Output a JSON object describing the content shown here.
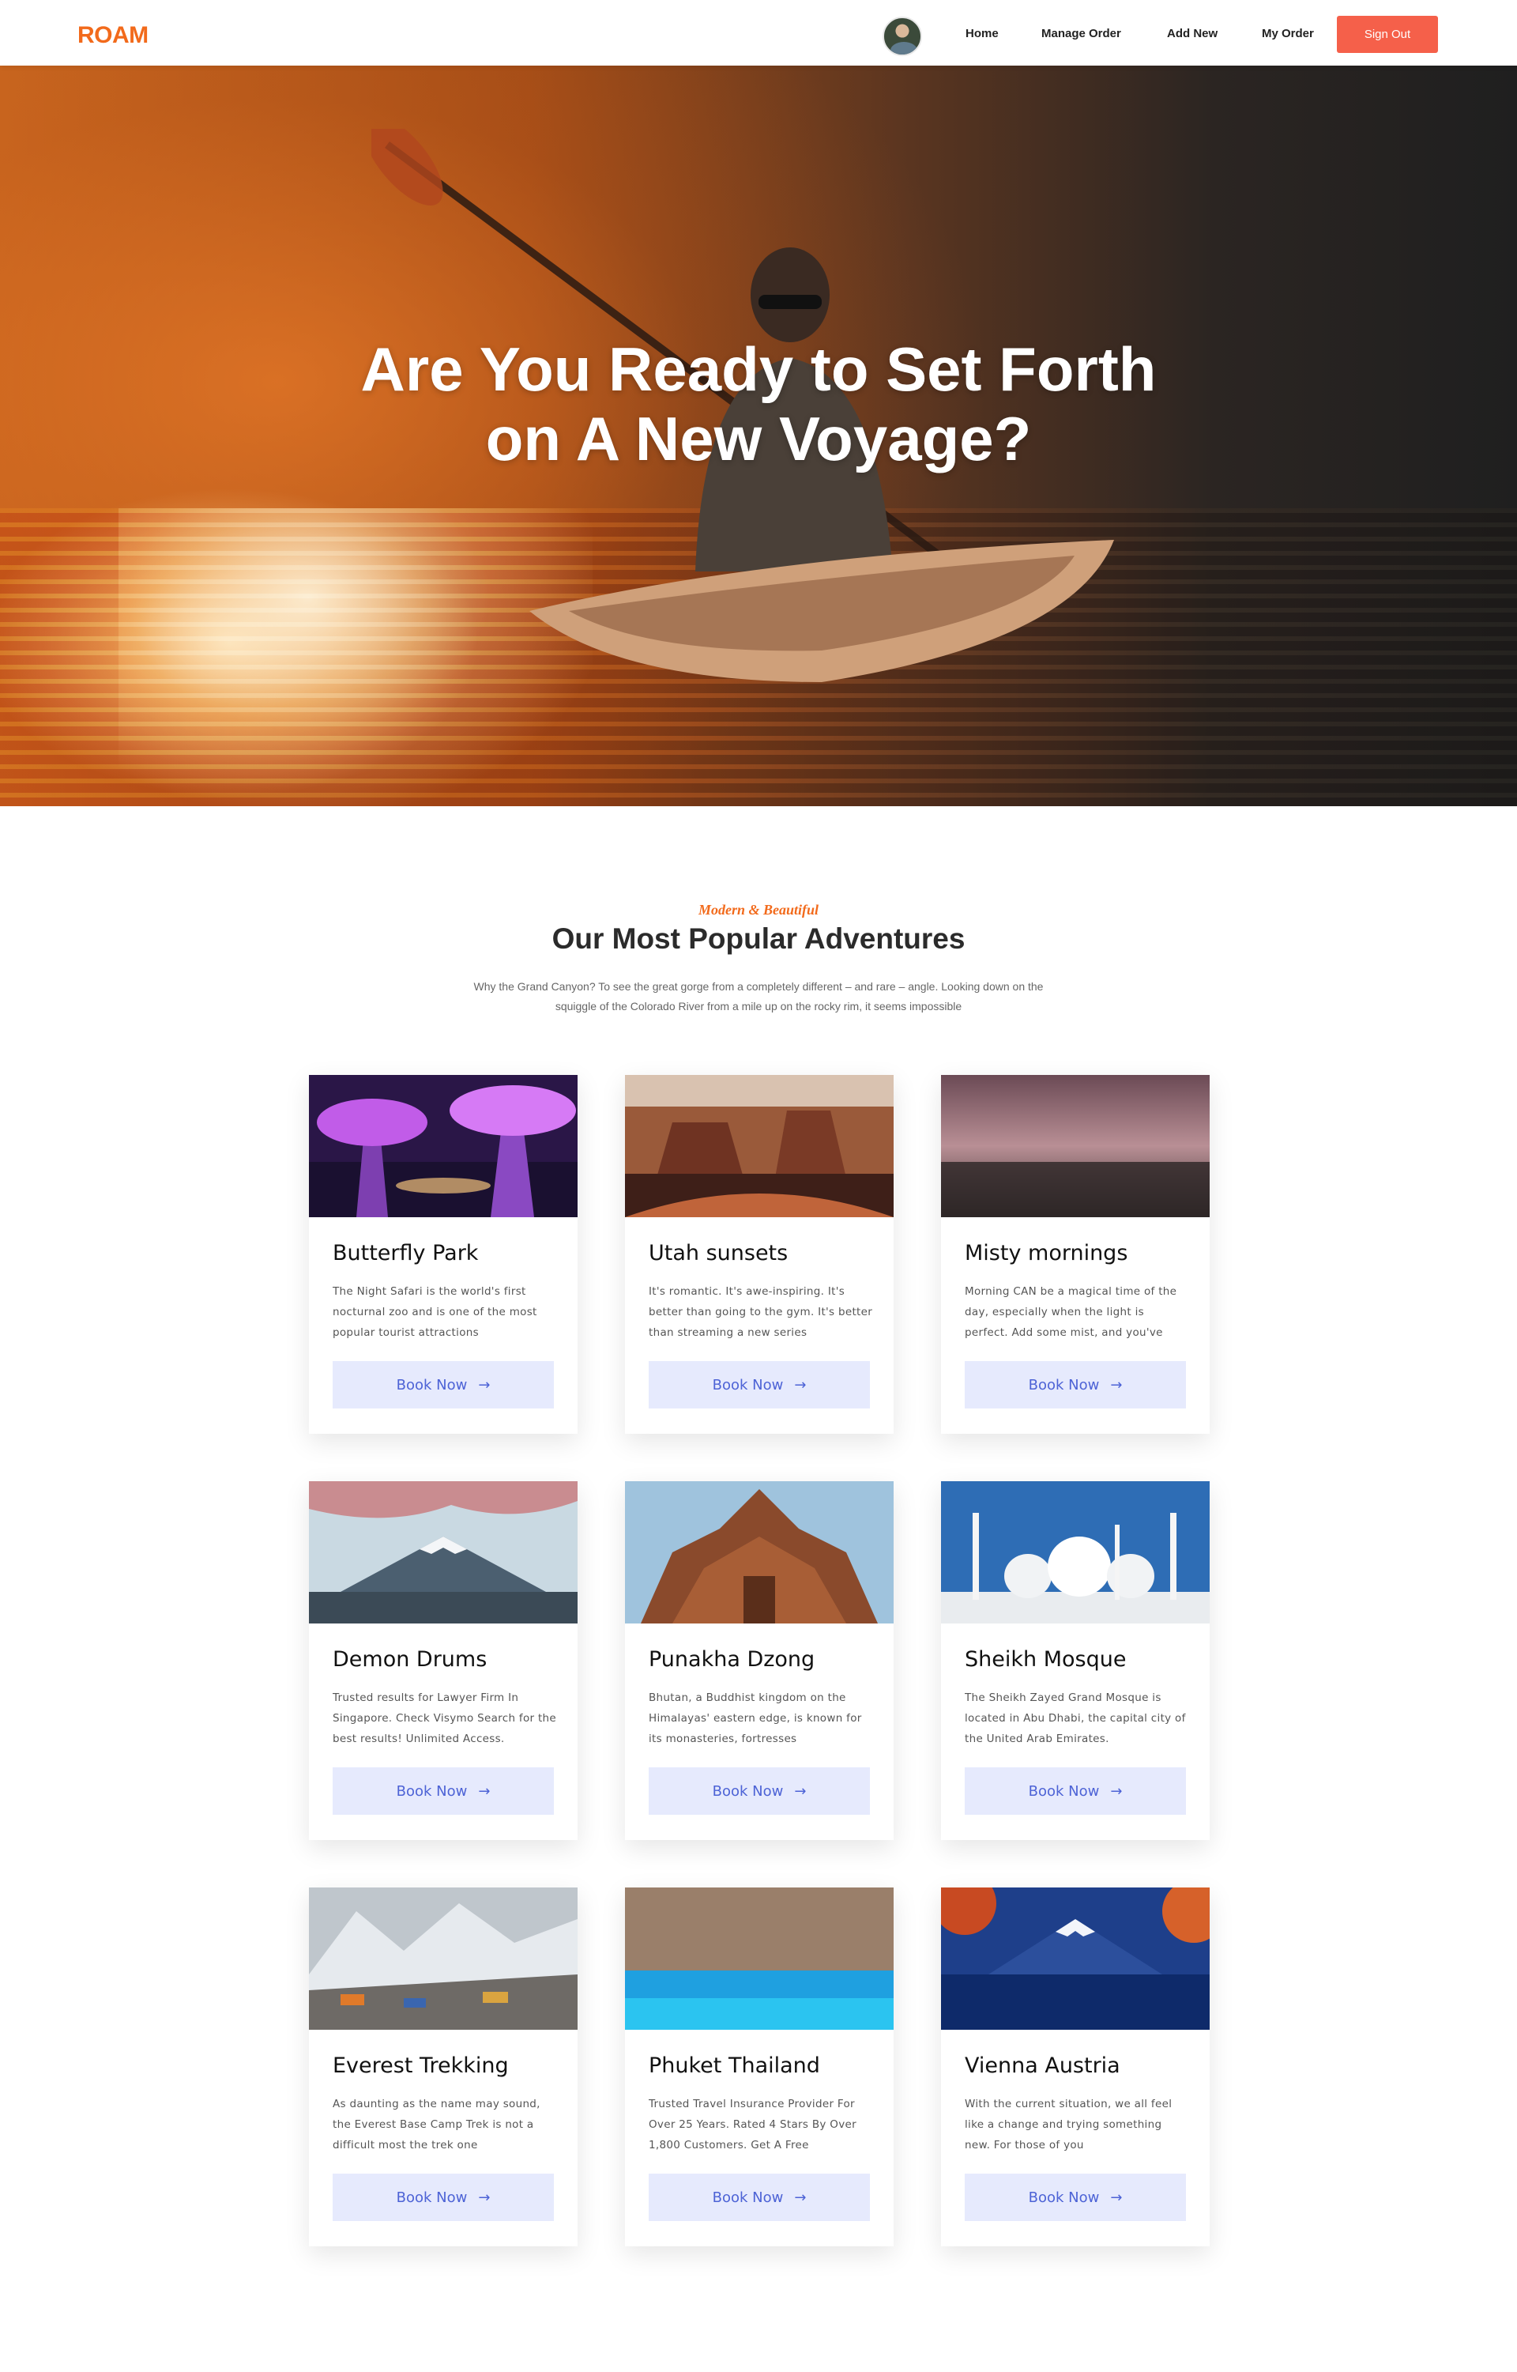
{
  "brand": {
    "logo": "ROAM",
    "accent": "#f26a1b",
    "button_color": "#f5604a"
  },
  "nav": {
    "links": [
      "Home",
      "Manage Order",
      "Add New",
      "My Order"
    ],
    "sign_out": "Sign Out"
  },
  "hero": {
    "title_line1": "Are You Ready to Set Forth",
    "title_line2": "on A New Voyage?"
  },
  "section": {
    "eyebrow": "Modern & Beautiful",
    "title": "Our Most Popular Adventures",
    "description": "Why the Grand Canyon? To see the great gorge from a completely different – and rare – angle. Looking down on the squiggle of the Colorado River from a mile up on the rocky rim, it seems impossible"
  },
  "cards": [
    {
      "title": "Butterfly Park",
      "desc": "The Night Safari is the world's first nocturnal zoo and is one of the most popular tourist attractions",
      "button": "Book Now",
      "image": "supertrees-photo"
    },
    {
      "title": "Utah sunsets",
      "desc": "It's romantic. It's awe-inspiring. It's better than going to the gym. It's better than streaming a new series",
      "button": "Book Now",
      "image": "monument-valley-photo"
    },
    {
      "title": "Misty mornings",
      "desc": "Morning CAN be a magical time of the day, especially when the light is perfect. Add some mist, and you've",
      "button": "Book Now",
      "image": "misty-field-photo"
    },
    {
      "title": "Demon Drums",
      "desc": "Trusted results for Lawyer Firm In Singapore. Check Visymo Search for the best results! Unlimited Access.",
      "button": "Book Now",
      "image": "mount-fuji-blossom-photo"
    },
    {
      "title": "Punakha Dzong",
      "desc": "Bhutan, a Buddhist kingdom on the Himalayas' eastern edge, is known for its monasteries, fortresses",
      "button": "Book Now",
      "image": "wooden-temple-photo"
    },
    {
      "title": "Sheikh Mosque",
      "desc": "The Sheikh Zayed Grand Mosque is located in Abu Dhabi, the capital city of the United Arab Emirates.",
      "button": "Book Now",
      "image": "mosque-photo"
    },
    {
      "title": "Everest Trekking",
      "desc": "As daunting as the name may sound, the Everest Base Camp Trek is not a difficult most the trek one",
      "button": "Book Now",
      "image": "everest-camp-photo"
    },
    {
      "title": "Phuket Thailand",
      "desc": "Trusted Travel Insurance Provider For Over 25 Years. Rated 4 Stars By Over 1,800 Customers. Get A Free",
      "button": "Book Now",
      "image": "phuket-lagoon-photo"
    },
    {
      "title": "Vienna Austria",
      "desc": "With the current situation, we all feel like a change and trying something new. For those of you",
      "button": "Book Now",
      "image": "fuji-lake-photo"
    }
  ]
}
